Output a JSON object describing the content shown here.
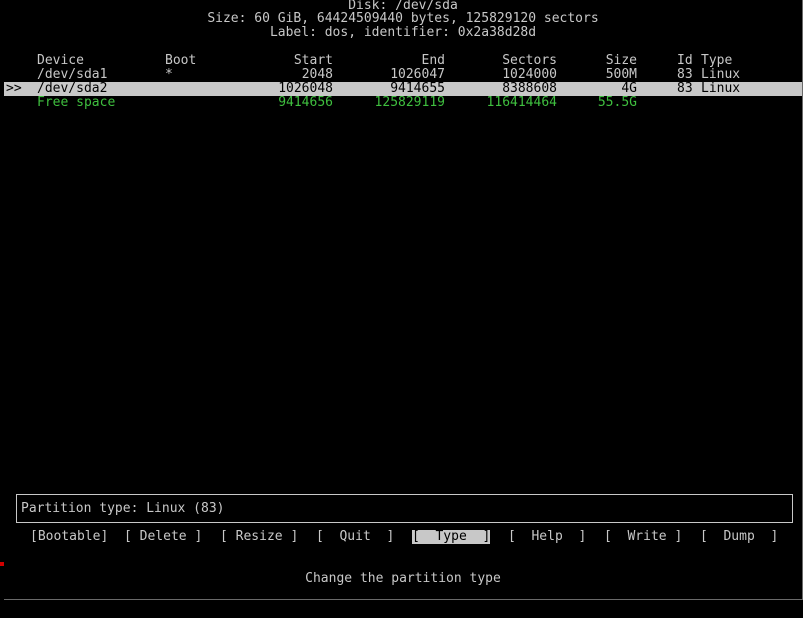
{
  "disk": {
    "title": "Disk: /dev/sda",
    "size_line": "Size: 60 GiB, 64424509440 bytes, 125829120 sectors",
    "label_line": "Label: dos, identifier: 0x2a38d28d"
  },
  "table": {
    "headers": {
      "device": "Device",
      "boot": "Boot",
      "start": "Start",
      "end": "End",
      "sectors": "Sectors",
      "size": "Size",
      "id": "Id",
      "type": "Type"
    },
    "rows": [
      {
        "marker": "",
        "device": "/dev/sda1",
        "boot": "*",
        "start": "2048",
        "end": "1026047",
        "sectors": "1024000",
        "size": "500M",
        "id": "83",
        "type": "Linux"
      },
      {
        "marker": ">>",
        "device": "/dev/sda2",
        "boot": "",
        "start": "1026048",
        "end": "9414655",
        "sectors": "8388608",
        "size": "4G",
        "id": "83",
        "type": "Linux"
      },
      {
        "marker": "",
        "device": "Free space",
        "boot": "",
        "start": "9414656",
        "end": "125829119",
        "sectors": "116414464",
        "size": "55.5G",
        "id": "",
        "type": ""
      }
    ]
  },
  "info": "Partition type: Linux (83)",
  "menu": {
    "bootable": "[Bootable]",
    "delete": "[ Delete ]",
    "resize": "[ Resize ]",
    "quit": "[  Quit  ]",
    "type": "[  Type  ]",
    "help": "[  Help  ]",
    "write": "[  Write ]",
    "dump": "[  Dump  ]"
  },
  "status": "Change the partition type",
  "colors": {
    "background": "#000000",
    "text": "#c8c8c8",
    "free_space": "#3fbf3f",
    "selection": "#c8c8c8"
  }
}
